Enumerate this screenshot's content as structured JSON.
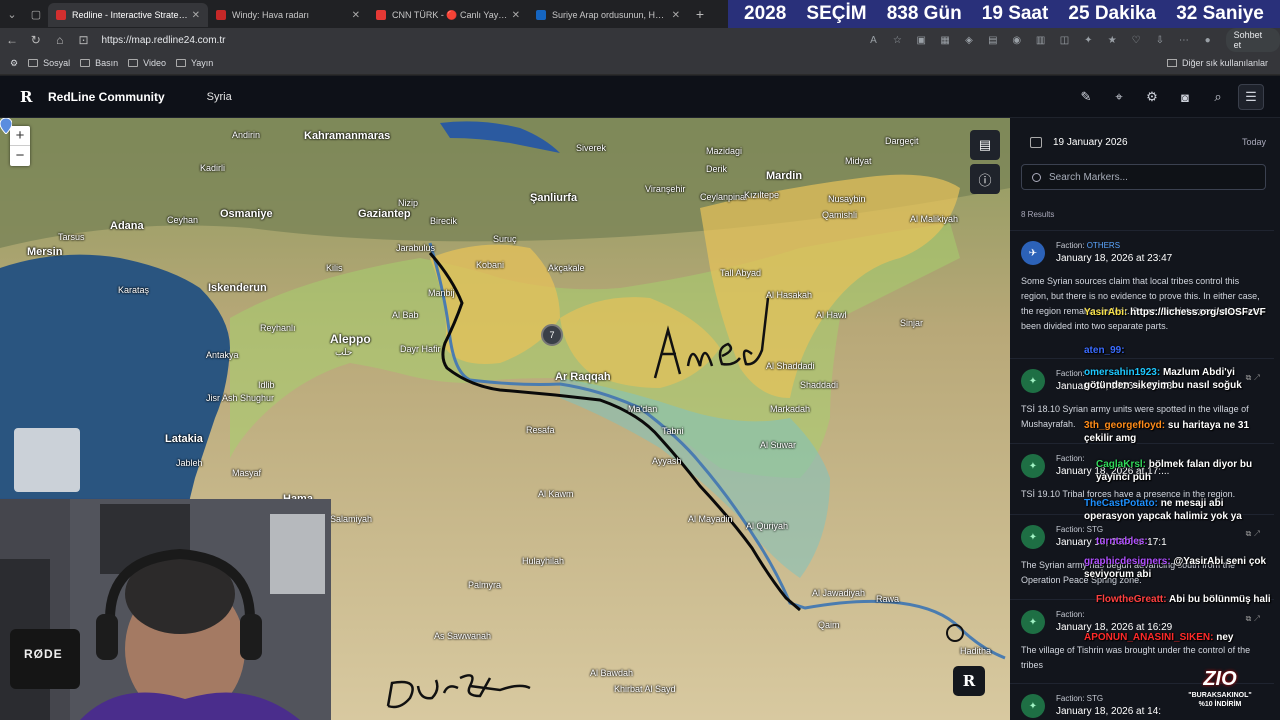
{
  "browser": {
    "tabs": [
      {
        "title": "Redline - Interactive Strategic Map",
        "color": "#d32f2f",
        "active": true
      },
      {
        "title": "Windy: Hava radarı",
        "color": "#c62828",
        "active": false
      },
      {
        "title": "CNN TÜRK - 🔴 Canlı Yayın ᴴᴰ - C",
        "color": "#e53935",
        "active": false
      },
      {
        "title": "Suriye Arap ordusunun, Haseke şe",
        "color": "#1565c0",
        "active": false
      }
    ],
    "new_tab": "+",
    "url": "https://map.redline24.com.tr",
    "profile_label": "Sohbet et",
    "bookmarks": [
      "Sosyal",
      "Basın",
      "Video",
      "Yayın"
    ],
    "other_bookmarks": "Diğer sık kullanılanlar"
  },
  "countdown": {
    "year": "2028",
    "label": "SEÇİM",
    "days": "838 Gün",
    "hours": "19 Saat",
    "minutes": "25 Dakika",
    "seconds": "32 Saniye"
  },
  "app": {
    "logo": "R",
    "name": "RedLine Community",
    "region": "Syria",
    "header_icons": [
      "pen-icon",
      "map-pin-icon",
      "gear-icon",
      "camera-icon",
      "search-icon",
      "menu-icon"
    ]
  },
  "map": {
    "zoom_in": "+",
    "zoom_out": "−",
    "cluster_count": "7",
    "badge": "R",
    "labels": {
      "kahramanmaras": "Kahramanmaras",
      "adana": "Adana",
      "mersin": "Mersin",
      "tarsus": "Tarsus",
      "osmaniye": "Osmaniye",
      "gaziantep": "Gaziantep",
      "sanliurfa": "Şanliurfa",
      "mardin": "Mardin",
      "iskenderun": "Iskenderun",
      "aleppo": "Aleppo",
      "aleppo_ar": "حلب",
      "latakia": "Latakia",
      "hama": "Hama",
      "ar_raqqah": "Ar Raqqah",
      "andirin": "Andirin",
      "kadirli": "Kadirli",
      "ceyhan": "Ceyhan",
      "karatas": "Karataş",
      "kilis": "Kilis",
      "jarabulus": "Jarabulus",
      "manbij": "Manbij",
      "kobani": "Kobani",
      "akcakale": "Akçakale",
      "tal_abyad": "Tall Abyad",
      "viransehir": "Viranşehir",
      "ceylanpinar": "Ceylanpinar",
      "al_hasakah": "Al Hasakah",
      "al_hawl": "Al Hawl",
      "qamishli": "Qamishli",
      "midyat": "Midyat",
      "dargecit": "Dargeçit",
      "suruc": "Suruç",
      "birecik": "Birecik",
      "nizip": "Nizip",
      "siverek": "Siverek",
      "derik": "Derik",
      "mazidagi": "Mazidagi",
      "kiziltepe": "Kızıltepe",
      "nusaybin": "Nusaybin",
      "al_malikiyah": "Al Malikiyah",
      "shuyukh": "Al Shaddadi",
      "markadah": "Markadah",
      "al_busayrah": "Al Suwar",
      "al_kawm": "Al Kawm",
      "resafa": "Resafa",
      "ayyash": "Ayyash",
      "tabni": "Tabni",
      "ma_dan": "Ma'dan",
      "al_mayadin": "Al Mayadin",
      "al_quriyah": "Al Quriyah",
      "as_sawwanah": "As Sawwanah",
      "palmyra": "Palmyra",
      "hulayhilah": "Hulayhilah",
      "al_bawdah": "Al Bawdah",
      "khirbat": "Khirbat Al Sayd",
      "al_qaim": "Qaim",
      "hadithah": "Haditha",
      "rawa": "Rawa",
      "ad_dana": "Dayr Hafir",
      "al_bab": "Al Bab",
      "idlib": "Idlib",
      "jisr": "Jisr Ash Shughur",
      "reyhanli": "Reyhanlı",
      "antakya": "Antakya",
      "jableh": "Jableh",
      "masyaf": "Masyaf",
      "salamiyah": "Salamiyah",
      "sinjar": "Sinjar",
      "shaddadi": "Shaddadi",
      "al_jawadiyah": "Al Jawadiyah"
    },
    "handwriting": [
      "Amed",
      "Duruz"
    ]
  },
  "sidebar": {
    "date": "19 January 2026",
    "today": "Today",
    "search_placeholder": "Search Markers...",
    "results": "8 Results",
    "entries": [
      {
        "faction_prefix": "Faction:",
        "faction": "OTHERS",
        "date": "January 18, 2026 at 23:47",
        "text": "Some Syrian sources claim that local tribes control this region, but there is no evidence to prove this. In either case, the region remains unclear. Some terrorist organization have been divided into two separate parts."
      },
      {
        "faction_prefix": "Faction:",
        "faction": "",
        "date": "January 18, 2026 at 22:23",
        "text": "TSİ 18.10 Syrian army units were spotted in the village of Mushayrafah."
      },
      {
        "faction_prefix": "Faction:",
        "faction": "",
        "date": "January 18, 2026 at 17:...",
        "text": "TSİ 19.10 Tribal forces have a presence in the region."
      },
      {
        "faction_prefix": "Faction: STG",
        "faction": "",
        "date": "January 18, 2026 at 17:1",
        "text": "The Syrian army has begun advancing south from the Operation Peace Spring zone."
      },
      {
        "faction_prefix": "Faction:",
        "faction": "",
        "date": "January 18, 2026 at 16:29",
        "text": "The village of Tishrin was brought under the control of the tribes"
      },
      {
        "faction_prefix": "Faction: STG",
        "faction": "",
        "date": "January 18, 2026 at 14:",
        "text": ""
      }
    ]
  },
  "chat": [
    {
      "user": "YasirAbi:",
      "msg": "https://lichess.org/sIOSFzVF",
      "color": "#f7e04a"
    },
    {
      "user": "aten_99:",
      "msg": "",
      "color": "#3b6cff"
    },
    {
      "user": "omersahin1923:",
      "msg": "Mazlum Abdi'yi götünden sikeyim bu nasıl soğuk",
      "color": "#1ec8ff"
    },
    {
      "user": "3th_georgefloyd:",
      "msg": "su haritaya ne 31 çekilir amg",
      "color": "#ff8c1a"
    },
    {
      "user": "CaglaKrsl:",
      "msg": "bölmek falan diyor bu yayıncı püh",
      "color": "#30d85a"
    },
    {
      "user": "TheCastPotato:",
      "msg": "ne mesaji abi operasyon yapcak halimiz yok ya",
      "color": "#1e90ff"
    },
    {
      "user": "turntables:",
      "msg": "",
      "color": "#b050ff"
    },
    {
      "user": "graphicdesigners:",
      "msg": "@YasirAbi seni çok seviyorum abi",
      "color": "#b050ff"
    },
    {
      "user": "FlowtheGreatt:",
      "msg": "Abi bu bölünmüş hali",
      "color": "#ff4040"
    },
    {
      "user": "APONUN_ANASINI_SIKEN:",
      "msg": "ney",
      "color": "#ff2a2a"
    }
  ],
  "overlay": {
    "webcam_mic": "RØDE",
    "sponsor_logo": "ZIO",
    "sponsor_code": "\"BURAKSAKINOL\"",
    "sponsor_offer": "%10 İNDİRİM"
  },
  "colors": {
    "countdown_bg": "#29307a",
    "app_header": "#0e1118",
    "sidebar_bg": "#12151c",
    "faction_link": "#5ba6ff",
    "sdf_zone": "#e6c25a",
    "gov_zone": "#9ccf6a",
    "tribe_zone": "#7fc3c0"
  }
}
